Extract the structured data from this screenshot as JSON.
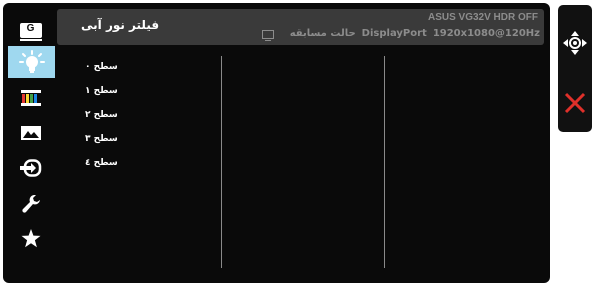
{
  "header": {
    "title": "فیلتر نور آبی",
    "model": "ASUS VG32V HDR OFF",
    "mode": "حالت مسابقه",
    "input": "DisplayPort",
    "resolution": "1920x1080@120Hz"
  },
  "sidebar": {
    "items": [
      {
        "icon": "game-visual-icon",
        "label": "G"
      },
      {
        "icon": "blue-light-filter-icon"
      },
      {
        "icon": "color-icon"
      },
      {
        "icon": "image-icon"
      },
      {
        "icon": "input-select-icon"
      },
      {
        "icon": "system-setup-icon"
      },
      {
        "icon": "my-favorite-icon"
      }
    ],
    "active_index": 1
  },
  "options": [
    "سطح ۰",
    "سطح ۱",
    "سطح ۲",
    "سطح ۳",
    "سطح ٤"
  ],
  "right_panel": {
    "items": [
      {
        "icon": "five-way-navigation-icon"
      },
      {
        "icon": "close-icon"
      }
    ]
  },
  "colors": {
    "osd_background": "#0a0a0a",
    "header_background": "#3a3a3a",
    "active_highlight": "#9fd8ef",
    "close_red": "#e0302a"
  }
}
